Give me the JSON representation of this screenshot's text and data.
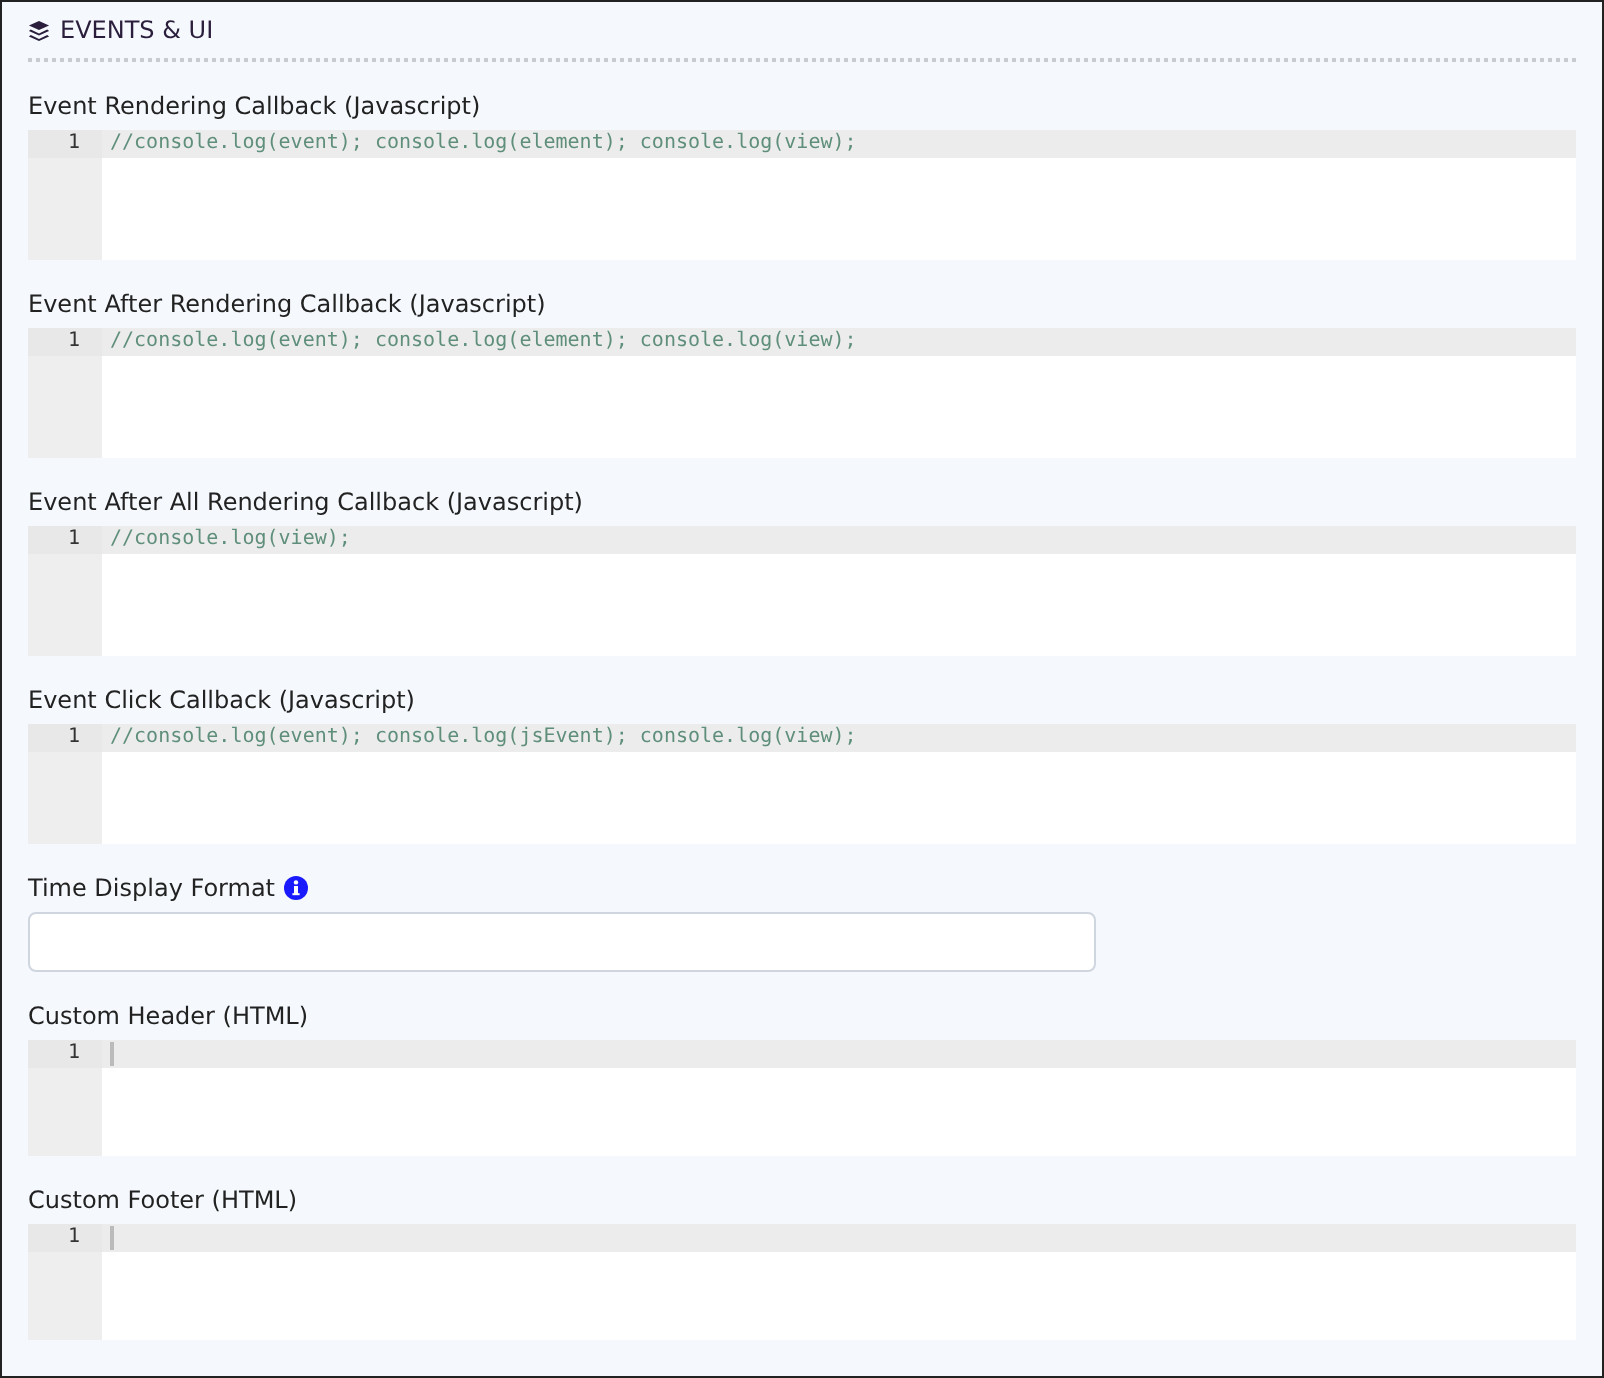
{
  "section": {
    "title": "EVENTS & UI"
  },
  "fields": [
    {
      "kind": "code",
      "label": "Event Rendering Callback (Javascript)",
      "line_number": "1",
      "code": "//console.log(event); console.log(element); console.log(view);"
    },
    {
      "kind": "code",
      "label": "Event After Rendering Callback (Javascript)",
      "line_number": "1",
      "code": "//console.log(event); console.log(element); console.log(view);"
    },
    {
      "kind": "code",
      "label": "Event After All Rendering Callback (Javascript)",
      "line_number": "1",
      "code": "//console.log(view);"
    },
    {
      "kind": "code",
      "label": "Event Click Callback (Javascript)",
      "line_number": "1",
      "code": "//console.log(event); console.log(jsEvent); console.log(view);"
    },
    {
      "kind": "text",
      "label": "Time Display Format",
      "info": true
    },
    {
      "kind": "code",
      "label": "Custom Header (HTML)",
      "line_number": "1"
    },
    {
      "kind": "code",
      "label": "Custom Footer (HTML)",
      "line_number": "1"
    }
  ]
}
